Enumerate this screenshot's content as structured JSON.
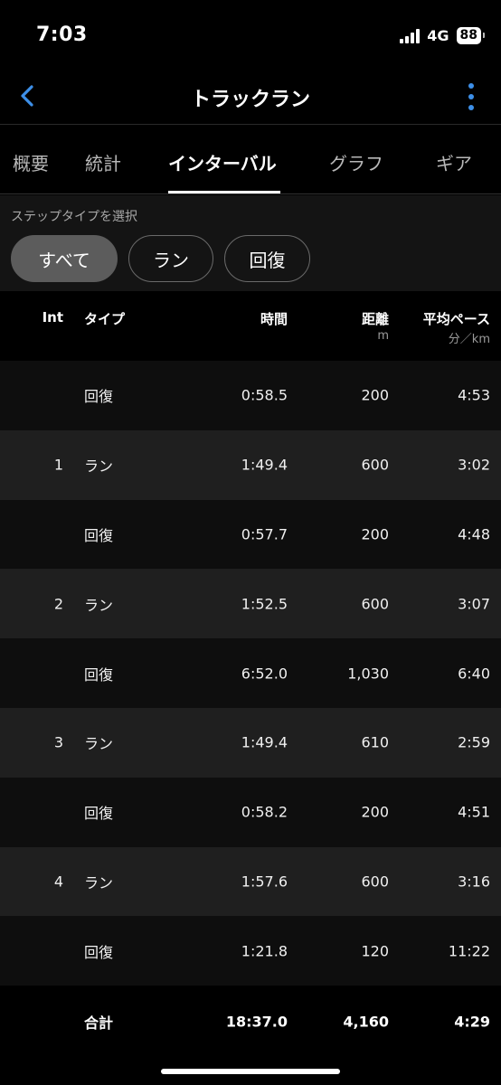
{
  "status": {
    "time": "7:03",
    "network": "4G",
    "battery": "88"
  },
  "nav": {
    "title": "トラックラン"
  },
  "tabs": [
    {
      "label": "概要"
    },
    {
      "label": "統計"
    },
    {
      "label": "インターバル"
    },
    {
      "label": "グラフ"
    },
    {
      "label": "ギア"
    }
  ],
  "filter": {
    "label": "ステップタイプを選択",
    "chips": [
      {
        "label": "すべて",
        "selected": true
      },
      {
        "label": "ラン",
        "selected": false
      },
      {
        "label": "回復",
        "selected": false
      }
    ]
  },
  "table": {
    "headers": {
      "int": "Int",
      "type": "タイプ",
      "time": "時間",
      "distance": "距離",
      "distance_unit": "m",
      "pace": "平均ペース",
      "pace_unit": "分／km"
    },
    "rows": [
      {
        "int": "",
        "type": "回復",
        "time": "0:58.5",
        "distance": "200",
        "pace": "4:53"
      },
      {
        "int": "1",
        "type": "ラン",
        "time": "1:49.4",
        "distance": "600",
        "pace": "3:02"
      },
      {
        "int": "",
        "type": "回復",
        "time": "0:57.7",
        "distance": "200",
        "pace": "4:48"
      },
      {
        "int": "2",
        "type": "ラン",
        "time": "1:52.5",
        "distance": "600",
        "pace": "3:07"
      },
      {
        "int": "",
        "type": "回復",
        "time": "6:52.0",
        "distance": "1,030",
        "pace": "6:40"
      },
      {
        "int": "3",
        "type": "ラン",
        "time": "1:49.4",
        "distance": "610",
        "pace": "2:59"
      },
      {
        "int": "",
        "type": "回復",
        "time": "0:58.2",
        "distance": "200",
        "pace": "4:51"
      },
      {
        "int": "4",
        "type": "ラン",
        "time": "1:57.6",
        "distance": "600",
        "pace": "3:16"
      },
      {
        "int": "",
        "type": "回復",
        "time": "1:21.8",
        "distance": "120",
        "pace": "11:22"
      }
    ],
    "total": {
      "label": "合計",
      "time": "18:37.0",
      "distance": "4,160",
      "pace": "4:29"
    }
  },
  "colors": {
    "accent": "#3d8fe8",
    "background": "#000000",
    "row_alt": "#1f1f1f"
  },
  "icons": {
    "back": "chevron-left-icon",
    "more": "more-vertical-icon"
  }
}
